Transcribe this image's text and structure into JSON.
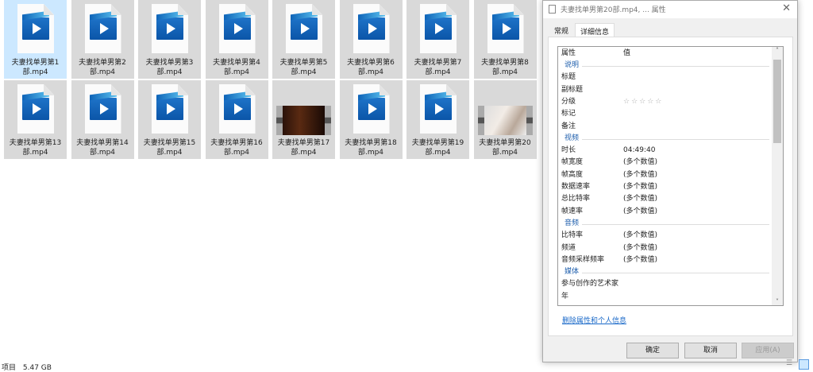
{
  "files": [
    {
      "name": "夫妻找单男第1",
      "ext": "部.mp4",
      "thumb": "icon",
      "selected": true
    },
    {
      "name": "夫妻找单男第2",
      "ext": "部.mp4",
      "thumb": "icon"
    },
    {
      "name": "夫妻找单男第3",
      "ext": "部.mp4",
      "thumb": "icon"
    },
    {
      "name": "夫妻找单男第4",
      "ext": "部.mp4",
      "thumb": "icon"
    },
    {
      "name": "夫妻找单男第5",
      "ext": "部.mp4",
      "thumb": "icon"
    },
    {
      "name": "夫妻找单男第6",
      "ext": "部.mp4",
      "thumb": "icon"
    },
    {
      "name": "夫妻找单男第7",
      "ext": "部.mp4",
      "thumb": "icon"
    },
    {
      "name": "夫妻找单男第8",
      "ext": "部.mp4",
      "thumb": "icon"
    },
    {
      "name": "夫妻找单男第13",
      "ext": "部.mp4",
      "thumb": "icon"
    },
    {
      "name": "夫妻找单男第14",
      "ext": "部.mp4",
      "thumb": "icon"
    },
    {
      "name": "夫妻找单男第15",
      "ext": "部.mp4",
      "thumb": "icon"
    },
    {
      "name": "夫妻找单男第16",
      "ext": "部.mp4",
      "thumb": "icon"
    },
    {
      "name": "夫妻找单男第17",
      "ext": "部.mp4",
      "thumb": "video-dark"
    },
    {
      "name": "夫妻找单男第18",
      "ext": "部.mp4",
      "thumb": "icon"
    },
    {
      "name": "夫妻找单男第19",
      "ext": "部.mp4",
      "thumb": "icon"
    },
    {
      "name": "夫妻找单男第20",
      "ext": "部.mp4",
      "thumb": "video-light"
    }
  ],
  "dialog": {
    "title": "夫妻找单男第20部.mp4, ... 属性",
    "tabs": [
      "常规",
      "详细信息"
    ],
    "header": {
      "prop": "属性",
      "value": "值"
    },
    "rows": [
      {
        "group": "说明"
      },
      {
        "k": "标题"
      },
      {
        "k": "副标题"
      },
      {
        "k": "分级",
        "v": "☆☆☆☆☆"
      },
      {
        "k": "标记"
      },
      {
        "k": "备注"
      },
      {
        "group": "视频"
      },
      {
        "k": "时长",
        "v": "04:49:40"
      },
      {
        "k": "帧宽度",
        "v": "(多个数值)"
      },
      {
        "k": "帧高度",
        "v": "(多个数值)"
      },
      {
        "k": "数据速率",
        "v": "(多个数值)"
      },
      {
        "k": "总比特率",
        "v": "(多个数值)"
      },
      {
        "k": "帧速率",
        "v": "(多个数值)"
      },
      {
        "group": "音频"
      },
      {
        "k": "比特率",
        "v": "(多个数值)"
      },
      {
        "k": "频道",
        "v": "(多个数值)"
      },
      {
        "k": "音频采样频率",
        "v": "(多个数值)"
      },
      {
        "group": "媒体"
      },
      {
        "k": "参与创作的艺术家"
      },
      {
        "k": "年"
      }
    ],
    "remove_link": "删除属性和个人信息",
    "ok": "确定",
    "cancel": "取消",
    "apply": "应用(A)"
  },
  "status": {
    "text": "项目",
    "size": "5.47 GB"
  }
}
